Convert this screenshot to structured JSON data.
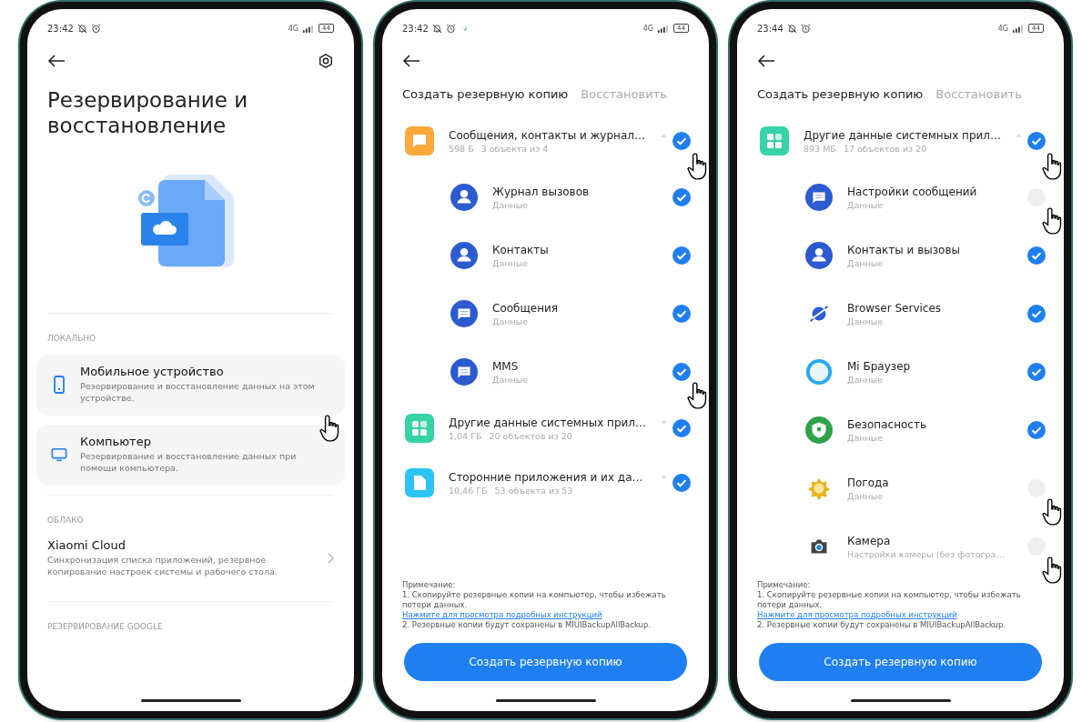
{
  "phones": [
    {
      "kind": "menu",
      "status": {
        "time": "23:42",
        "network": "4G",
        "battery": "44"
      },
      "title": "Резервирование и восстановление",
      "sections": [
        {
          "heading": "ЛОКАЛЬНО",
          "items": [
            {
              "kind": "phone",
              "title": "Мобильное устройство",
              "description": "Резервирование и восстановление данных на этом устройстве.",
              "pointer": true
            },
            {
              "kind": "monitor",
              "title": "Компьютер",
              "description": "Резервирование и восстановление данных при помощи компьютера."
            }
          ]
        },
        {
          "heading": "ОБЛАКО",
          "items": [
            {
              "kind": "link",
              "title": "Xiaomi Cloud",
              "description": "Синхронизация списка приложений, резервное копирование настроек системы и рабочего стола."
            }
          ]
        },
        {
          "heading": "РЕЗЕРВИРОВАНИЕ GOOGLE"
        }
      ]
    },
    {
      "kind": "backup",
      "status": {
        "time": "23:42",
        "notification_icon": true,
        "network": "4G",
        "battery": "44"
      },
      "tabs": [
        {
          "label": "Создать резервную копию",
          "selected": true
        },
        {
          "label": "Восстановить",
          "selected": false
        }
      ],
      "groups": [
        {
          "kind": "messages",
          "title": "Сообщения, контакты и журнал…",
          "size": "598 Б",
          "count": "3 объекта из 4",
          "expanded": true,
          "checked": true,
          "pointer": true,
          "children": [
            {
              "kind": "person",
              "title": "Журнал вызовов",
              "subtitle": "Данные",
              "checked": true
            },
            {
              "kind": "person",
              "title": "Контакты",
              "subtitle": "Данные",
              "checked": true
            },
            {
              "kind": "chat",
              "title": "Сообщения",
              "subtitle": "Данные",
              "checked": true
            },
            {
              "kind": "chat",
              "title": "MMS",
              "subtitle": "Данные",
              "checked": true,
              "pointer": true
            }
          ]
        },
        {
          "kind": "grid",
          "title": "Другие данные системных прил…",
          "size": "1,04 ГБ",
          "count": "20 объектов из 20",
          "expanded": false,
          "checked": true
        },
        {
          "kind": "file",
          "title": "Сторонние приложения и их да…",
          "size": "10,46 ГБ",
          "count": "53 объекта из 53",
          "expanded": false,
          "checked": true
        }
      ],
      "note": {
        "heading": "Примечание:",
        "line1": "1. Скопируйте резервные копии на компьютер, чтобы избежать потери данных.",
        "link": "Нажмите для просмотра подробных инструкций",
        "line2": "2. Резервные копии будут сохранены в MIUIBackupAllBackup."
      },
      "button": "Создать резервную копию"
    },
    {
      "kind": "backup",
      "status": {
        "time": "23:44",
        "network": "4G",
        "battery": "44"
      },
      "tabs": [
        {
          "label": "Создать резервную копию",
          "selected": true
        },
        {
          "label": "Восстановить",
          "selected": false
        }
      ],
      "groups": [
        {
          "kind": "grid",
          "title": "Другие данные системных прил…",
          "size": "893 МБ",
          "count": "17 объектов из 20",
          "expanded": true,
          "checked": true,
          "pointer": true,
          "children": [
            {
              "kind": "chat",
              "title": "Настройки сообщений",
              "subtitle": "Данные",
              "checked": false,
              "pointer": true
            },
            {
              "kind": "person",
              "title": "Контакты и вызовы",
              "subtitle": "Данные",
              "checked": true
            },
            {
              "kind": "planet",
              "title": "Browser Services",
              "subtitle": "Данные",
              "checked": true
            },
            {
              "kind": "browser",
              "title": "Mi Браузер",
              "subtitle": "Данные",
              "checked": true
            },
            {
              "kind": "shield",
              "title": "Безопасность",
              "subtitle": "Данные",
              "checked": true
            },
            {
              "kind": "sun",
              "title": "Погода",
              "subtitle": "Данные",
              "checked": false,
              "pointer": true
            },
            {
              "kind": "camera",
              "title": "Камера",
              "subtitle": "Настройки камеры (без фотогра…",
              "checked": false,
              "pointer": true
            }
          ]
        }
      ],
      "note": {
        "heading": "Примечание:",
        "line1": "1. Скопируйте резервные копии на компьютер, чтобы избежать потери данных.",
        "link": "Нажмите для просмотра подробных инструкций",
        "line2": "2. Резервные копии будут сохранены в MIUIBackupAllBackup."
      },
      "button": "Создать резервную копию"
    }
  ]
}
